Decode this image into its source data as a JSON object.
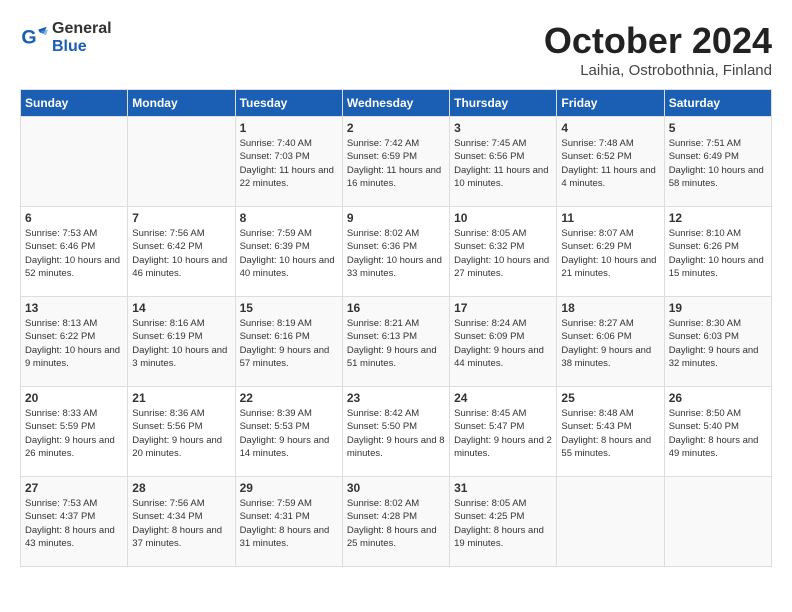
{
  "logo": {
    "general": "General",
    "blue": "Blue"
  },
  "title": "October 2024",
  "location": "Laihia, Ostrobothnia, Finland",
  "days_header": [
    "Sunday",
    "Monday",
    "Tuesday",
    "Wednesday",
    "Thursday",
    "Friday",
    "Saturday"
  ],
  "weeks": [
    [
      {
        "day": "",
        "info": ""
      },
      {
        "day": "",
        "info": ""
      },
      {
        "day": "1",
        "sunrise": "Sunrise: 7:40 AM",
        "sunset": "Sunset: 7:03 PM",
        "daylight": "Daylight: 11 hours and 22 minutes."
      },
      {
        "day": "2",
        "sunrise": "Sunrise: 7:42 AM",
        "sunset": "Sunset: 6:59 PM",
        "daylight": "Daylight: 11 hours and 16 minutes."
      },
      {
        "day": "3",
        "sunrise": "Sunrise: 7:45 AM",
        "sunset": "Sunset: 6:56 PM",
        "daylight": "Daylight: 11 hours and 10 minutes."
      },
      {
        "day": "4",
        "sunrise": "Sunrise: 7:48 AM",
        "sunset": "Sunset: 6:52 PM",
        "daylight": "Daylight: 11 hours and 4 minutes."
      },
      {
        "day": "5",
        "sunrise": "Sunrise: 7:51 AM",
        "sunset": "Sunset: 6:49 PM",
        "daylight": "Daylight: 10 hours and 58 minutes."
      }
    ],
    [
      {
        "day": "6",
        "sunrise": "Sunrise: 7:53 AM",
        "sunset": "Sunset: 6:46 PM",
        "daylight": "Daylight: 10 hours and 52 minutes."
      },
      {
        "day": "7",
        "sunrise": "Sunrise: 7:56 AM",
        "sunset": "Sunset: 6:42 PM",
        "daylight": "Daylight: 10 hours and 46 minutes."
      },
      {
        "day": "8",
        "sunrise": "Sunrise: 7:59 AM",
        "sunset": "Sunset: 6:39 PM",
        "daylight": "Daylight: 10 hours and 40 minutes."
      },
      {
        "day": "9",
        "sunrise": "Sunrise: 8:02 AM",
        "sunset": "Sunset: 6:36 PM",
        "daylight": "Daylight: 10 hours and 33 minutes."
      },
      {
        "day": "10",
        "sunrise": "Sunrise: 8:05 AM",
        "sunset": "Sunset: 6:32 PM",
        "daylight": "Daylight: 10 hours and 27 minutes."
      },
      {
        "day": "11",
        "sunrise": "Sunrise: 8:07 AM",
        "sunset": "Sunset: 6:29 PM",
        "daylight": "Daylight: 10 hours and 21 minutes."
      },
      {
        "day": "12",
        "sunrise": "Sunrise: 8:10 AM",
        "sunset": "Sunset: 6:26 PM",
        "daylight": "Daylight: 10 hours and 15 minutes."
      }
    ],
    [
      {
        "day": "13",
        "sunrise": "Sunrise: 8:13 AM",
        "sunset": "Sunset: 6:22 PM",
        "daylight": "Daylight: 10 hours and 9 minutes."
      },
      {
        "day": "14",
        "sunrise": "Sunrise: 8:16 AM",
        "sunset": "Sunset: 6:19 PM",
        "daylight": "Daylight: 10 hours and 3 minutes."
      },
      {
        "day": "15",
        "sunrise": "Sunrise: 8:19 AM",
        "sunset": "Sunset: 6:16 PM",
        "daylight": "Daylight: 9 hours and 57 minutes."
      },
      {
        "day": "16",
        "sunrise": "Sunrise: 8:21 AM",
        "sunset": "Sunset: 6:13 PM",
        "daylight": "Daylight: 9 hours and 51 minutes."
      },
      {
        "day": "17",
        "sunrise": "Sunrise: 8:24 AM",
        "sunset": "Sunset: 6:09 PM",
        "daylight": "Daylight: 9 hours and 44 minutes."
      },
      {
        "day": "18",
        "sunrise": "Sunrise: 8:27 AM",
        "sunset": "Sunset: 6:06 PM",
        "daylight": "Daylight: 9 hours and 38 minutes."
      },
      {
        "day": "19",
        "sunrise": "Sunrise: 8:30 AM",
        "sunset": "Sunset: 6:03 PM",
        "daylight": "Daylight: 9 hours and 32 minutes."
      }
    ],
    [
      {
        "day": "20",
        "sunrise": "Sunrise: 8:33 AM",
        "sunset": "Sunset: 5:59 PM",
        "daylight": "Daylight: 9 hours and 26 minutes."
      },
      {
        "day": "21",
        "sunrise": "Sunrise: 8:36 AM",
        "sunset": "Sunset: 5:56 PM",
        "daylight": "Daylight: 9 hours and 20 minutes."
      },
      {
        "day": "22",
        "sunrise": "Sunrise: 8:39 AM",
        "sunset": "Sunset: 5:53 PM",
        "daylight": "Daylight: 9 hours and 14 minutes."
      },
      {
        "day": "23",
        "sunrise": "Sunrise: 8:42 AM",
        "sunset": "Sunset: 5:50 PM",
        "daylight": "Daylight: 9 hours and 8 minutes."
      },
      {
        "day": "24",
        "sunrise": "Sunrise: 8:45 AM",
        "sunset": "Sunset: 5:47 PM",
        "daylight": "Daylight: 9 hours and 2 minutes."
      },
      {
        "day": "25",
        "sunrise": "Sunrise: 8:48 AM",
        "sunset": "Sunset: 5:43 PM",
        "daylight": "Daylight: 8 hours and 55 minutes."
      },
      {
        "day": "26",
        "sunrise": "Sunrise: 8:50 AM",
        "sunset": "Sunset: 5:40 PM",
        "daylight": "Daylight: 8 hours and 49 minutes."
      }
    ],
    [
      {
        "day": "27",
        "sunrise": "Sunrise: 7:53 AM",
        "sunset": "Sunset: 4:37 PM",
        "daylight": "Daylight: 8 hours and 43 minutes."
      },
      {
        "day": "28",
        "sunrise": "Sunrise: 7:56 AM",
        "sunset": "Sunset: 4:34 PM",
        "daylight": "Daylight: 8 hours and 37 minutes."
      },
      {
        "day": "29",
        "sunrise": "Sunrise: 7:59 AM",
        "sunset": "Sunset: 4:31 PM",
        "daylight": "Daylight: 8 hours and 31 minutes."
      },
      {
        "day": "30",
        "sunrise": "Sunrise: 8:02 AM",
        "sunset": "Sunset: 4:28 PM",
        "daylight": "Daylight: 8 hours and 25 minutes."
      },
      {
        "day": "31",
        "sunrise": "Sunrise: 8:05 AM",
        "sunset": "Sunset: 4:25 PM",
        "daylight": "Daylight: 8 hours and 19 minutes."
      },
      {
        "day": "",
        "info": ""
      },
      {
        "day": "",
        "info": ""
      }
    ]
  ]
}
